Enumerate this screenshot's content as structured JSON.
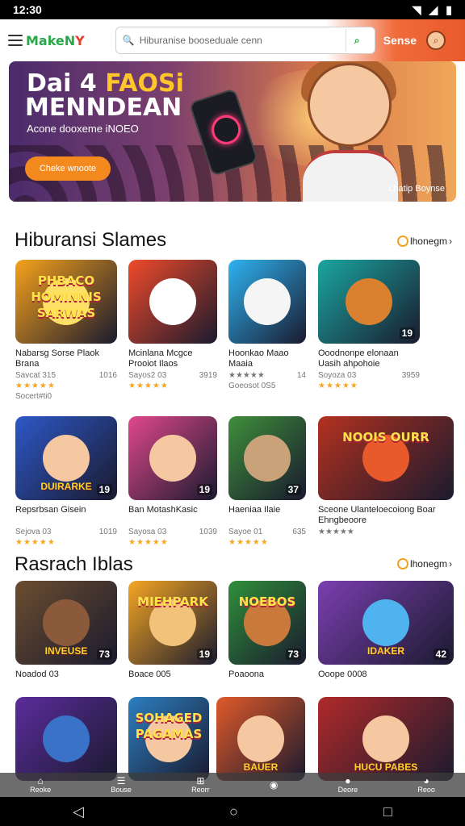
{
  "status": {
    "time": "12:30"
  },
  "header": {
    "logo_a": "MakeN",
    "logo_b": "Y",
    "search_placeholder": "Hiburanise booseduale cenn",
    "search_btn": "Sense"
  },
  "banner": {
    "line1_a": "Dai 4 ",
    "line1_b": "FAOSi",
    "line2": "MENNDEAN",
    "sub": "Acone dooxeme iNOEO",
    "cta": "Cheke wnoote",
    "corner": "Lhatip Boynse"
  },
  "section1": {
    "title": "Hiburansi Slames",
    "more": "lhonegm",
    "row1": [
      {
        "label": "PHBACO HOMINNIS SARWAS",
        "name": "Nabarsg Sorse Plaok Brana",
        "left": "Savcat 315",
        "right": "1016",
        "stars": "★★★★★",
        "extra": "Socert#ti0",
        "tag": "",
        "bg": "#f6a21c",
        "art": "#ffe066"
      },
      {
        "label": "",
        "name": "Mcinlana Mcgce Prooiot Ilaos",
        "left": "Sayos2 03",
        "right": "3919",
        "stars": "★★★★★",
        "extra": "",
        "tag": "",
        "bg": "#f04a2a",
        "art": "#ffffff"
      },
      {
        "label": "",
        "name": "Hoonkao Maao Maaia",
        "left": "★★★★★",
        "right": "14",
        "stars": "",
        "extra": "Goeosot 0S5",
        "tag": "",
        "bg": "#2eb3f0",
        "art": "#f5f5f5"
      },
      {
        "label": "",
        "name": "Ooodnonpe elonaan Uasih ahpohoie",
        "left": "Soyoza 03",
        "right": "3959",
        "stars": "★★★★★",
        "extra": "",
        "tag": "19",
        "bg": "#1aa6a0",
        "art": "#d9812f"
      }
    ],
    "row2": [
      {
        "label": "",
        "blabel": "DUIRARKE",
        "name": "Repsrbsan Gisein",
        "left": "Sejova 03",
        "right": "1019",
        "stars": "★★★★★",
        "tag": "19",
        "bg": "#2d58c7",
        "art": "#f6c8a1"
      },
      {
        "label": "",
        "name": "Ban MotashKasic",
        "left": "Sayosa 03",
        "right": "1039",
        "stars": "★★★★★",
        "tag": "19",
        "bg": "#e0488c",
        "art": "#f6c8a1"
      },
      {
        "label": "",
        "name": "Haeniaa Ilaie",
        "left": "Sayoe 01",
        "right": "635",
        "stars": "★★★★★",
        "tag": "37",
        "bg": "#3e8e3a",
        "art": "#c9a27a"
      },
      {
        "label": "NOOIS OURR",
        "name": "Sceone Ulanteloecoiong Boar Ehngbeoore",
        "left": "★★★★★",
        "right": "",
        "stars": "",
        "tag": "",
        "bg": "#b3311f",
        "art": "#e85a2c"
      }
    ]
  },
  "section2": {
    "title": "Rasrach Iblas",
    "more": "lhonegm",
    "row1": [
      {
        "blabel": "INVEUSE",
        "name": "Noadod 03",
        "tag": "73",
        "bg": "#6b4d2f",
        "art": "#8a5a3a"
      },
      {
        "label": "MIEHPARK",
        "name": "Boace 005",
        "tag": "19",
        "bg": "#f5a623",
        "art": "#f2c27a"
      },
      {
        "label": "NOEBOS",
        "name": "Poaoona",
        "tag": "73",
        "bg": "#2f8f3a",
        "art": "#c97a3a"
      },
      {
        "blabel": "IDAKER",
        "name": "Ooope 0008",
        "tag": "42",
        "bg": "#7b3fb0",
        "art": "#4fb3f0"
      }
    ],
    "row2": [
      {
        "name": "",
        "tag": "",
        "bg": "#5b2c9c",
        "art": "#3a72c7"
      },
      {
        "label": "SOHAGED PAGAMAS",
        "name": "",
        "tag": "",
        "bg": "#2c7fc0",
        "art": "#f6c8a1"
      },
      {
        "blabel": "BAUER",
        "name": "",
        "tag": "",
        "bg": "#e05a2a",
        "art": "#f6c8a1"
      },
      {
        "blabel": "HUCU PABES",
        "name": "",
        "tag": "",
        "bg": "#b02a2a",
        "art": "#f6c8a1"
      }
    ]
  },
  "navbar": [
    "Reoke",
    "Bouse",
    "Reorr",
    "",
    "Deore",
    "Reoo"
  ]
}
